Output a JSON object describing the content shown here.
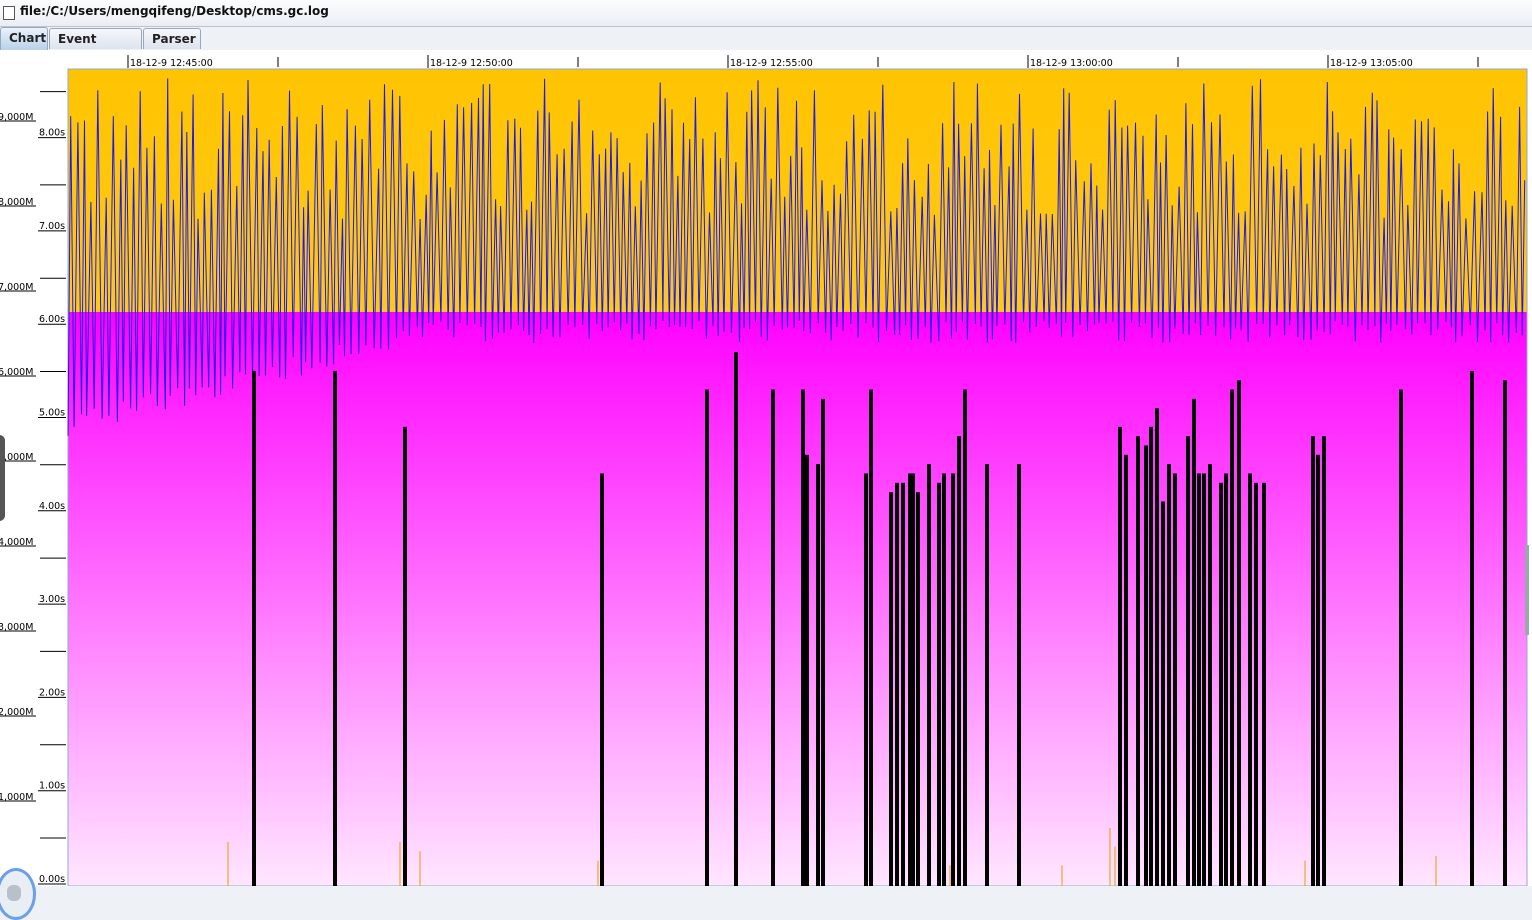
{
  "window": {
    "title": "file:/C:/Users/mengqifeng/Desktop/cms.gc.log",
    "icon": "document-icon"
  },
  "tabs": [
    {
      "label": "Chart",
      "active": true
    },
    {
      "label": "Event details",
      "active": false
    },
    {
      "label": "Parser",
      "active": false
    }
  ],
  "colors": {
    "tenured": "#ffc400",
    "young": "#ff00ff",
    "heap_used_line": "#1a1aee",
    "pause_bars": "#000000",
    "small_pauses": "#e0a000"
  },
  "chart_data": {
    "type": "line",
    "x_ticks": [
      "18-12-9 12:45:00",
      "18-12-9 12:50:00",
      "18-12-9 12:55:00",
      "18-12-9 13:00:00",
      "18-12-9 13:05:00"
    ],
    "y_left_ticks": [
      "1,000M",
      "2,000M",
      "3,000M",
      "4,000M",
      "5,000M",
      "6,000M",
      "7,000M",
      "8,000M",
      "9,000M"
    ],
    "y_right_ticks": [
      "0.00s",
      "1.00s",
      "2.00s",
      "3.00s",
      "4.00s",
      "5.00s",
      "6.00s",
      "7.00s",
      "8.00s"
    ],
    "series": [
      {
        "name": "",
        "kind": "heap-used",
        "ylim": [
          5000,
          9300
        ]
      }
    ],
    "tenured_boundary_M": 6550,
    "pause_seconds": [
      5.5,
      5.5,
      4.9,
      4.4,
      5.3,
      5.7,
      5.3,
      5.3,
      4.6,
      4.5,
      5.2,
      4.4,
      5.3,
      4.2,
      4.3,
      4.3,
      4.4,
      4.4,
      4.2,
      4.5,
      4.3,
      4.4,
      4.4,
      4.8,
      5.3,
      4.5,
      4.5,
      4.9,
      4.6,
      4.8,
      4.7,
      4.9,
      5.1,
      4.1,
      4.5,
      4.4,
      4.8,
      5.2,
      4.4,
      4.4,
      4.5,
      4.3,
      4.4,
      5.3,
      5.4,
      4.4
    ]
  }
}
